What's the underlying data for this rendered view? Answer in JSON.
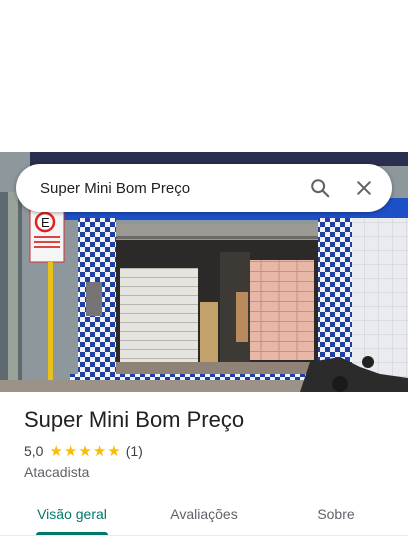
{
  "search": {
    "query": "Super Mini Bom Preço",
    "search_icon": "search-icon",
    "close_icon": "close-icon"
  },
  "photo": {
    "subject": "storefront"
  },
  "place": {
    "title": "Super Mini Bom Preço",
    "rating": "5,0",
    "stars": 5,
    "review_count": "(1)",
    "category": "Atacadista"
  },
  "tabs": [
    {
      "label": "Visão geral",
      "active": true
    },
    {
      "label": "Avaliações",
      "active": false
    },
    {
      "label": "Sobre",
      "active": false
    }
  ],
  "colors": {
    "accent": "#00796b",
    "star": "#fbbc04",
    "tile_blue": "#1f3fa3"
  }
}
